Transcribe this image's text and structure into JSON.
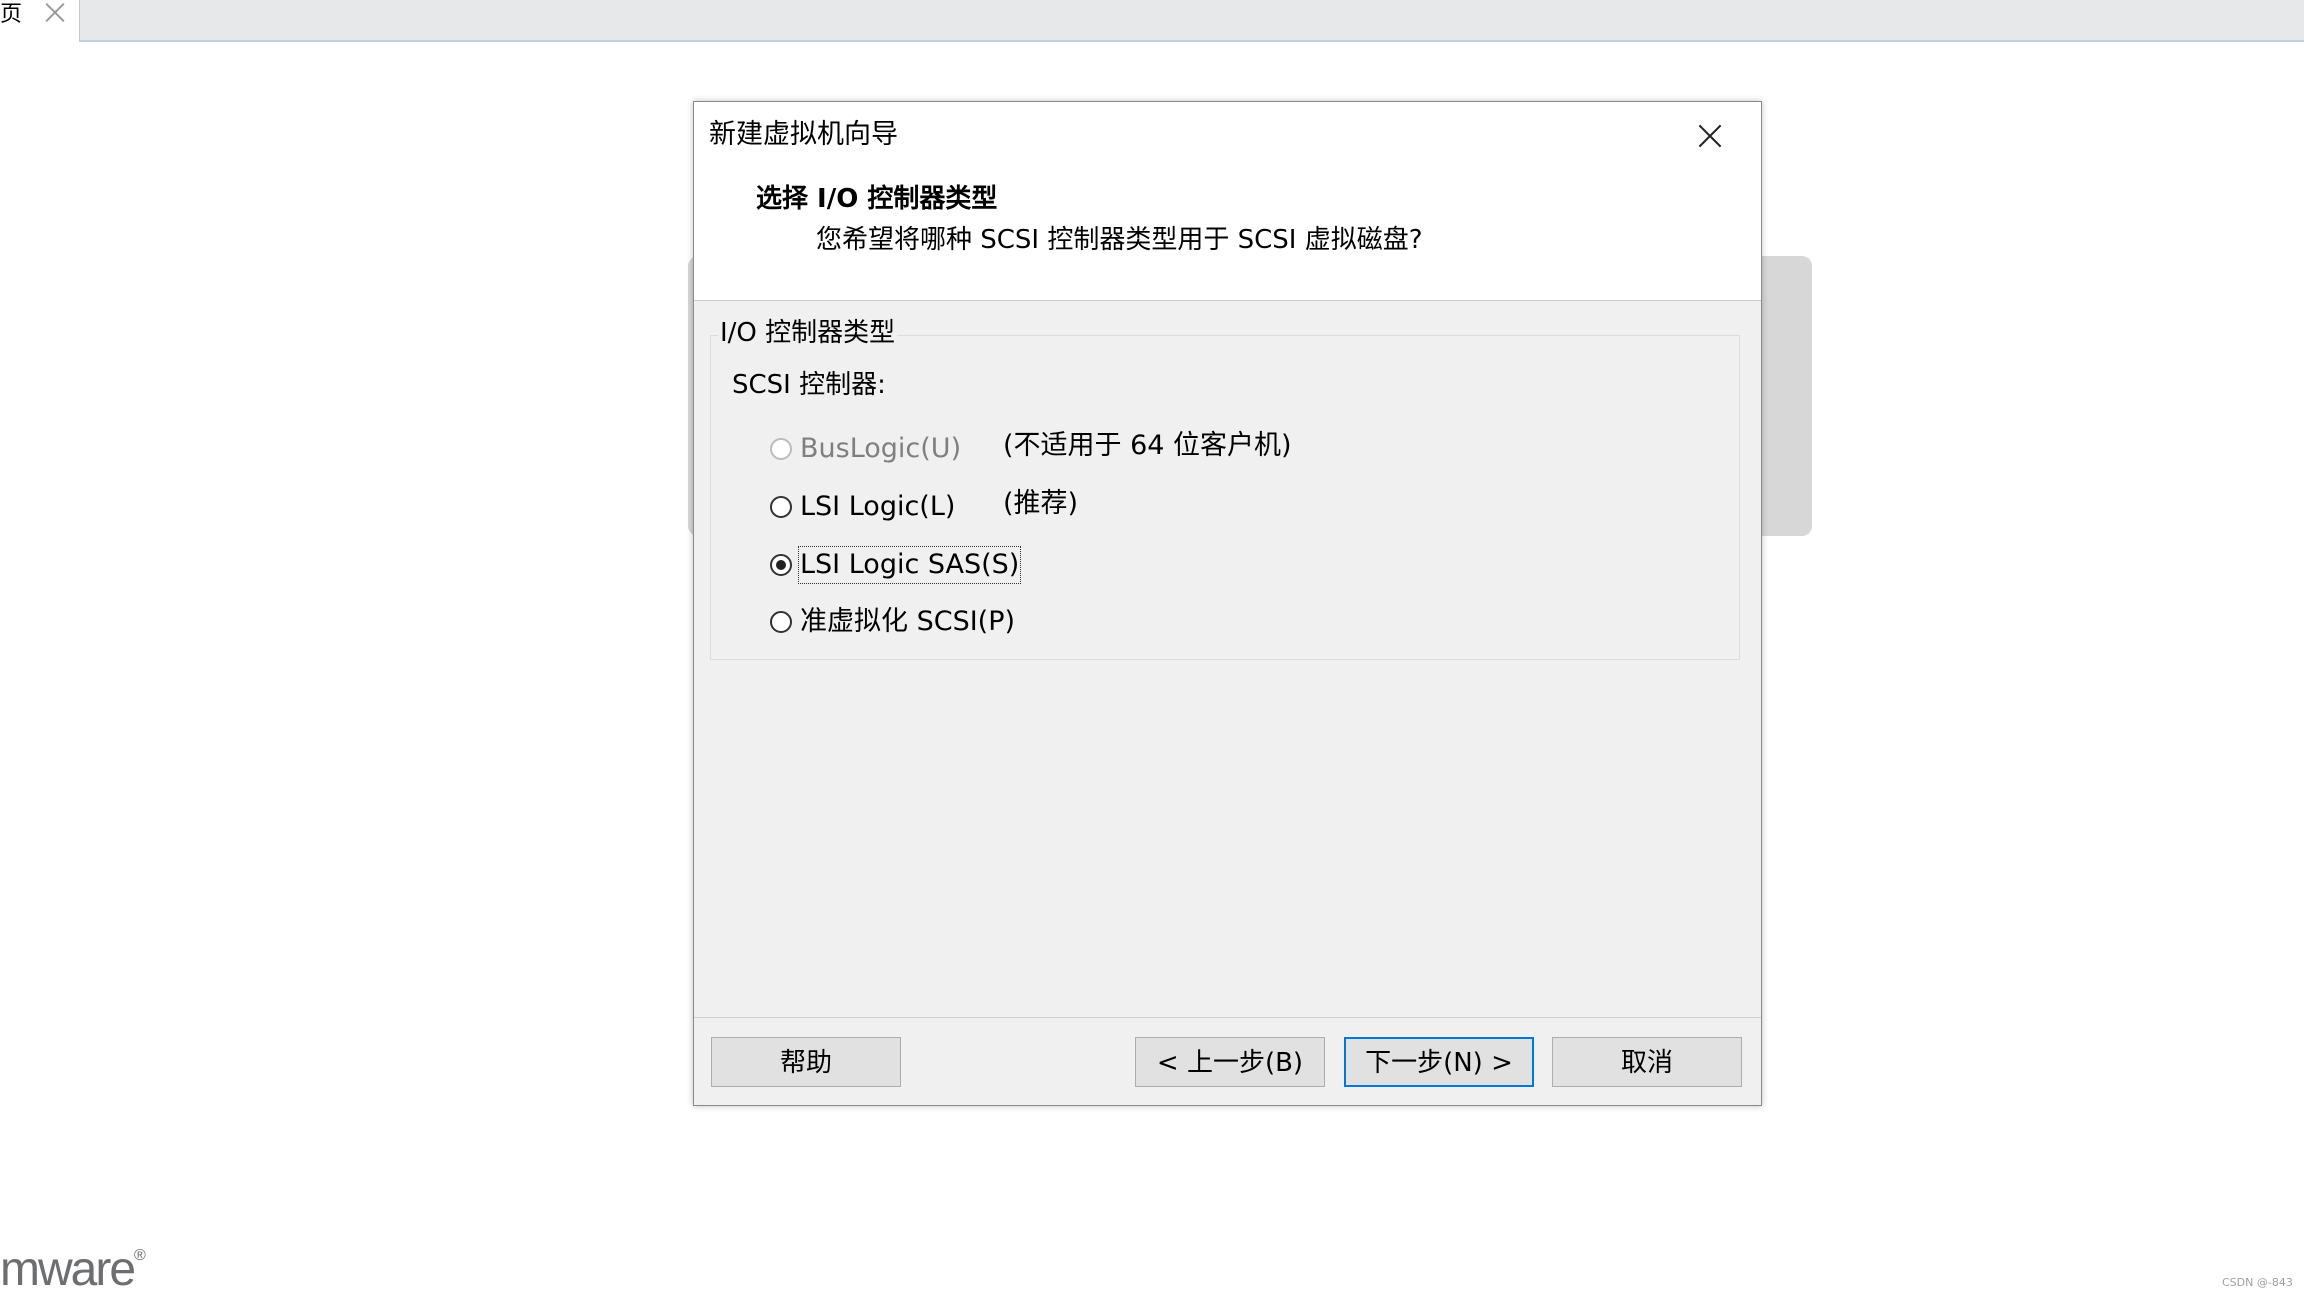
{
  "tab": {
    "label": "页"
  },
  "dialog": {
    "title": "新建虚拟机向导",
    "heading": "选择 I/O 控制器类型",
    "subheading": "您希望将哪种 SCSI 控制器类型用于 SCSI 虚拟磁盘?",
    "group_label": "I/O 控制器类型",
    "controller_label": "SCSI 控制器:",
    "options": [
      {
        "label": "BusLogic(U)",
        "note": "(不适用于 64 位客户机)",
        "checked": false,
        "disabled": true
      },
      {
        "label": "LSI Logic(L)",
        "note": "(推荐)",
        "checked": false,
        "disabled": false
      },
      {
        "label": "LSI Logic SAS(S)",
        "note": "",
        "checked": true,
        "disabled": false
      },
      {
        "label": "准虚拟化 SCSI(P)",
        "note": "",
        "checked": false,
        "disabled": false
      }
    ],
    "buttons": {
      "help": "帮助",
      "back": "< 上一步(B)",
      "next": "下一步(N) >",
      "cancel": "取消"
    }
  },
  "logo": {
    "text": "mware",
    "mark": "®"
  },
  "watermark": "CSDN @-843",
  "colors": {
    "default_button_border": "#0078d7",
    "dialog_bg": "#f0f0f0",
    "tab_strip": "#e6e8ea"
  }
}
